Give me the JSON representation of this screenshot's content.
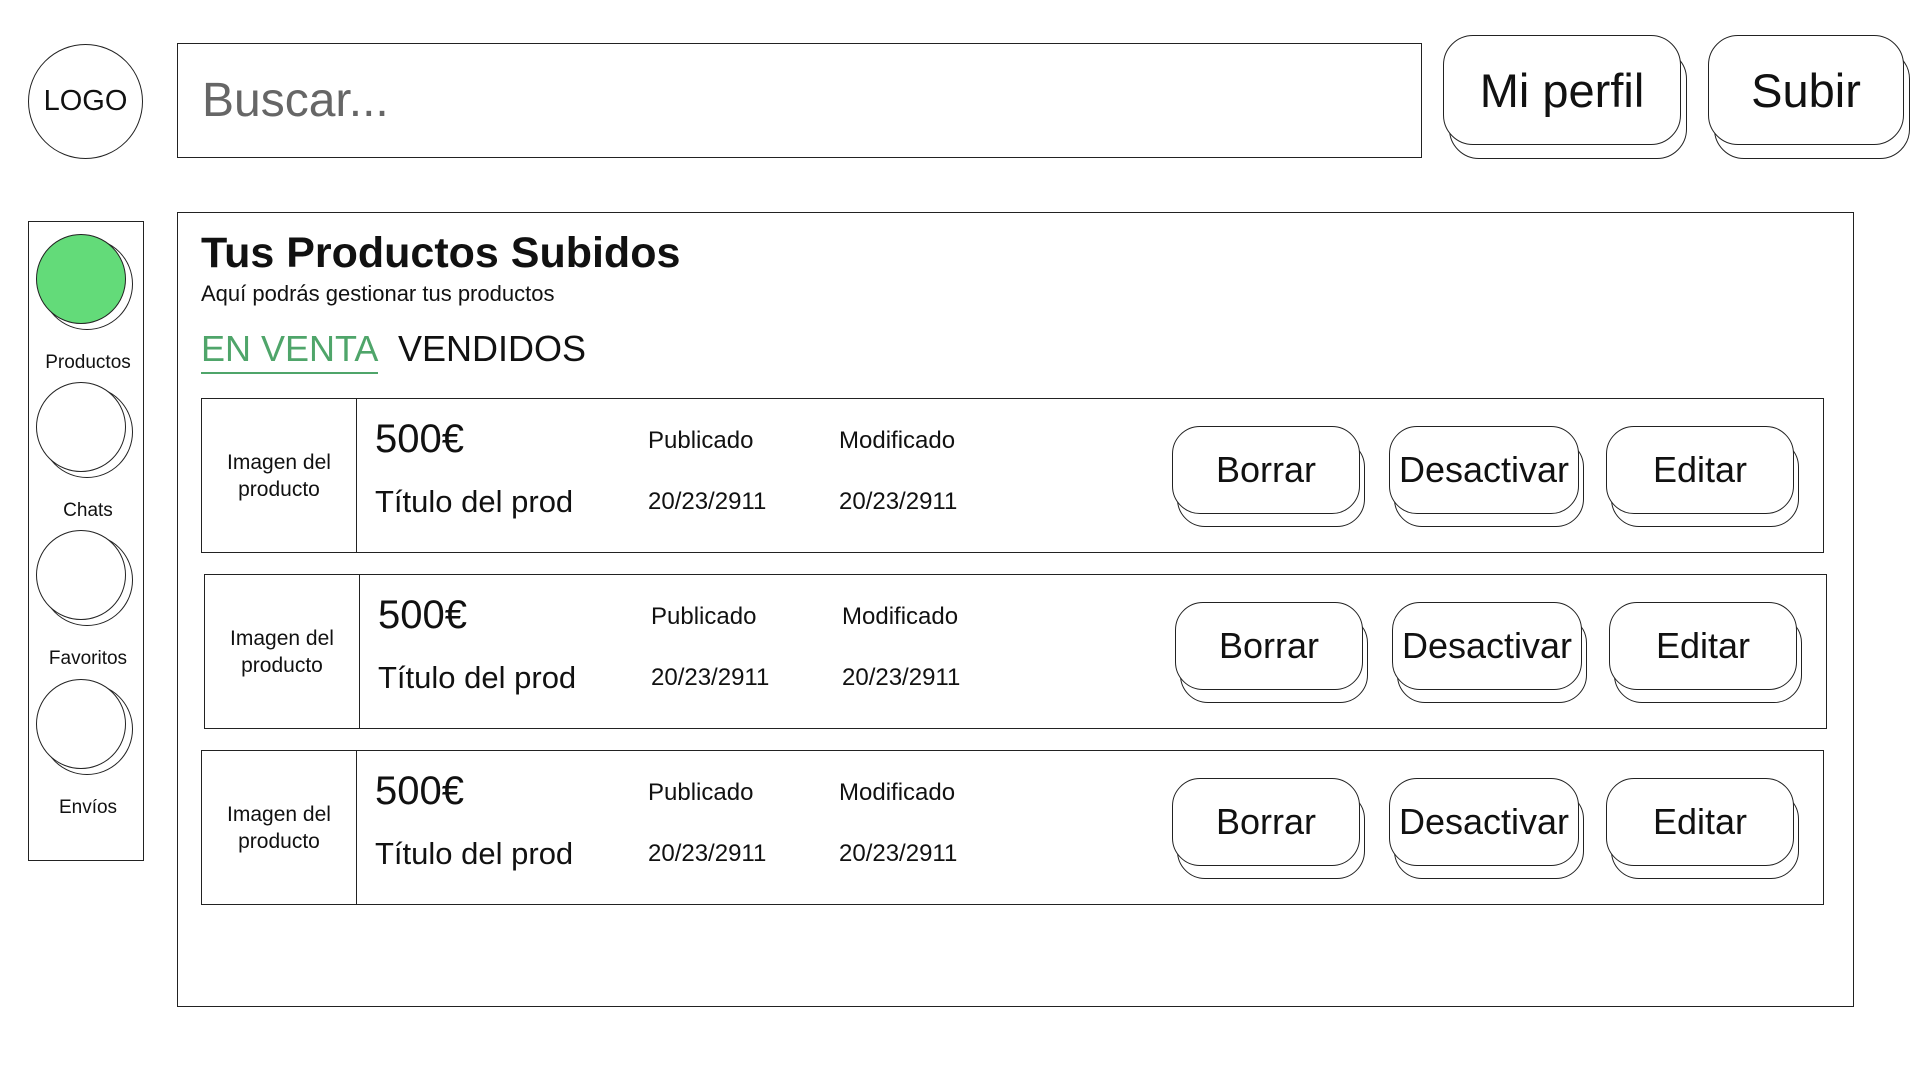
{
  "header": {
    "logo_text": "LOGO",
    "search_placeholder": "Buscar...",
    "profile_button": "Mi perfil",
    "upload_button": "Subir"
  },
  "sidebar": {
    "items": [
      {
        "label": "Productos",
        "active": true
      },
      {
        "label": "Chats",
        "active": false
      },
      {
        "label": "Favoritos",
        "active": false
      },
      {
        "label": "Envíos",
        "active": false
      }
    ]
  },
  "main": {
    "title": "Tus Productos Subidos",
    "subtitle": "Aquí podrás gestionar tus productos",
    "tabs": [
      {
        "label": "EN VENTA",
        "active": true
      },
      {
        "label": "VENDIDOS",
        "active": false
      }
    ],
    "products": [
      {
        "image_label": "Imagen del producto",
        "price": "500€",
        "title": "Título del prod",
        "published_label": "Publicado",
        "published_date": "20/23/2911",
        "modified_label": "Modificado",
        "modified_date": "20/23/2911",
        "delete_label": "Borrar",
        "deactivate_label": "Desactivar",
        "edit_label": "Editar"
      },
      {
        "image_label": "Imagen del producto",
        "price": "500€",
        "title": "Título del prod",
        "published_label": "Publicado",
        "published_date": "20/23/2911",
        "modified_label": "Modificado",
        "modified_date": "20/23/2911",
        "delete_label": "Borrar",
        "deactivate_label": "Desactivar",
        "edit_label": "Editar"
      },
      {
        "image_label": "Imagen del producto",
        "price": "500€",
        "title": "Título del prod",
        "published_label": "Publicado",
        "published_date": "20/23/2911",
        "modified_label": "Modificado",
        "modified_date": "20/23/2911",
        "delete_label": "Borrar",
        "deactivate_label": "Desactivar",
        "edit_label": "Editar"
      }
    ]
  },
  "colors": {
    "accent_active_tab": "#4fa56a",
    "active_sidebar_circle": "#63db79",
    "border": "#222222",
    "placeholder_text": "#666666"
  }
}
